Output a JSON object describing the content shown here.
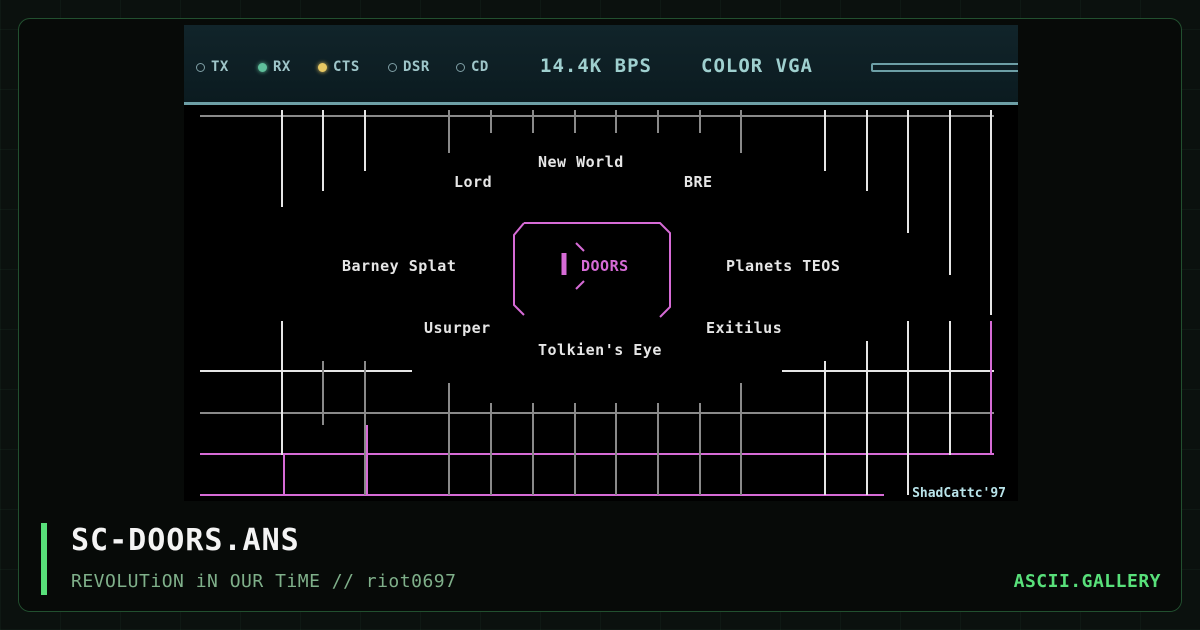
{
  "modem": {
    "leds": [
      {
        "label": "TX",
        "state": "off"
      },
      {
        "label": "RX",
        "state": "green"
      },
      {
        "label": "CTS",
        "state": "yellow"
      },
      {
        "label": "DSR",
        "state": "off"
      },
      {
        "label": "CD",
        "state": "off"
      }
    ],
    "speed": "14.4K BPS",
    "display": "COLOR VGA"
  },
  "art": {
    "doors": {
      "new_world": "New World",
      "lord": "Lord",
      "bre": "BRE",
      "barney_splat": "Barney Splat",
      "center": "DOORS",
      "planets": "Planets TEOS",
      "usurper": "Usurper",
      "exitilus": "Exitilus",
      "tolkiens": "Tolkien's Eye"
    },
    "signature": "ShadCattc'97",
    "colors": {
      "white": "#e6e6e6",
      "gray": "#8a8a8a",
      "magenta": "#d66bd6"
    }
  },
  "caption": {
    "title": "SC-DOORS.ANS",
    "subtitle": "REVOLUTiON iN OUR TiME // riot0697",
    "site": "ASCII.GALLERY"
  },
  "theme": {
    "accent": "#58e07a",
    "background": "#0b110e"
  }
}
